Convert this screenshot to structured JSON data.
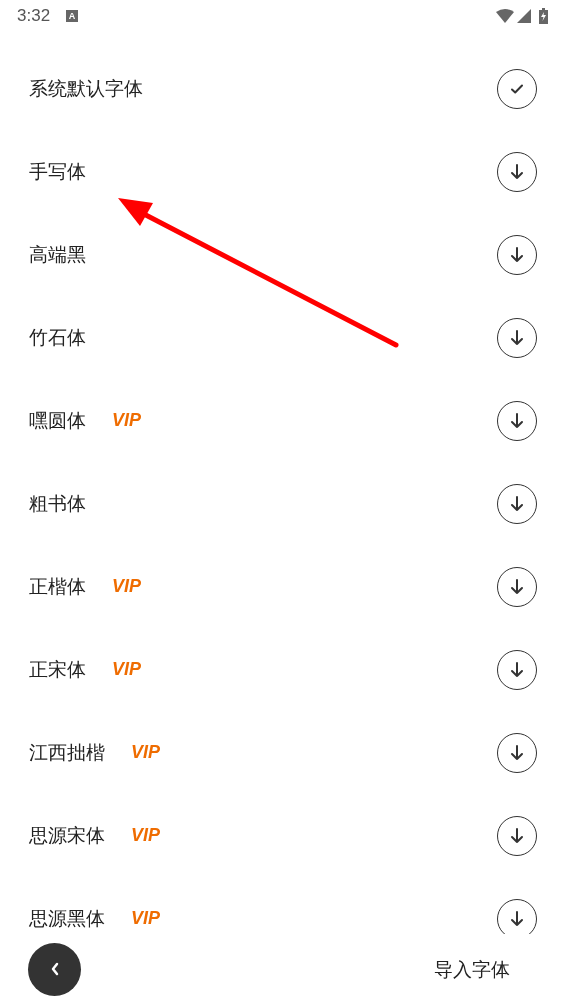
{
  "status_bar": {
    "time": "3:32",
    "notification_glyph": "A"
  },
  "fonts": [
    {
      "name": "系统默认字体",
      "installed": true
    },
    {
      "name": "手写体",
      "installed": false
    },
    {
      "name": "高端黑",
      "installed": false
    },
    {
      "name": "竹石体",
      "installed": false
    },
    {
      "name": "嘿圆体",
      "badge": "VIP",
      "installed": false
    },
    {
      "name": "粗书体",
      "installed": false
    },
    {
      "name": "正楷体",
      "badge": "VIP",
      "installed": false
    },
    {
      "name": "正宋体",
      "badge": "VIP",
      "installed": false
    },
    {
      "name": "江西拙楷",
      "badge": "VIP",
      "installed": false
    },
    {
      "name": "思源宋体",
      "badge": "VIP",
      "installed": false
    },
    {
      "name": "思源黑体",
      "badge": "VIP",
      "installed": false
    }
  ],
  "bottom_bar": {
    "import_label": "导入字体"
  }
}
